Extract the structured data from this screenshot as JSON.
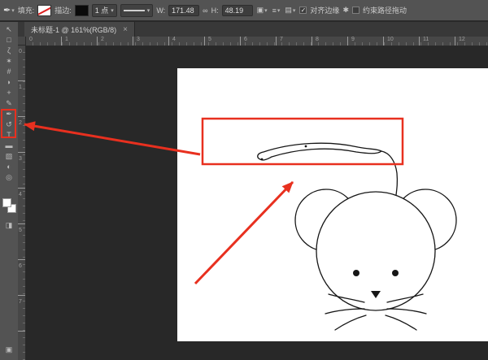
{
  "window": {
    "theme_colors": {
      "options_bar": "#535353",
      "pasteboard": "#282828",
      "canvas": "#ffffff",
      "ink": "#161616",
      "annotation_red": "#e8301f"
    }
  },
  "icons": {
    "pen": "✒",
    "dropdown": "▾",
    "link": "∞",
    "check": "✓",
    "path_ops": "▣",
    "path_align": "≡",
    "path_arrange": "▤",
    "gear": "✱",
    "quick_mask": "◨",
    "screen_mode": "▣"
  },
  "options_bar": {
    "fill_label": "填充:",
    "stroke_label": "描边:",
    "stroke_width": "1 点",
    "w_label": "W:",
    "w_value": "171.48",
    "h_label": "H:",
    "h_value": "48.19",
    "align_edges_label": "对齐边缘",
    "constrain_path_label": "约束路径拖动"
  },
  "tab_bar": {
    "document_title": "未标题-1 @ 161%(RGB/8)",
    "close_icon": "×"
  },
  "toolbar": {
    "tools": [
      {
        "name": "move-tool-icon",
        "glyph": "↖"
      },
      {
        "name": "marquee-tool-icon",
        "glyph": "□"
      },
      {
        "name": "lasso-tool-icon",
        "glyph": "ζ"
      },
      {
        "name": "quick-selection-tool-icon",
        "glyph": "✶"
      },
      {
        "name": "crop-tool-icon",
        "glyph": "#"
      },
      {
        "name": "eyedropper-tool-icon",
        "glyph": "◗"
      },
      {
        "name": "healing-brush-tool-icon",
        "glyph": "+"
      },
      {
        "name": "brush-tool-icon",
        "glyph": "✎"
      },
      {
        "name": "pen-tool-icon",
        "glyph": "✒"
      },
      {
        "name": "history-brush-tool-icon",
        "glyph": "↺"
      },
      {
        "name": "type-tool-icon",
        "glyph": "T"
      },
      {
        "name": "eraser-tool-icon",
        "glyph": "▬"
      },
      {
        "name": "gradient-tool-icon",
        "glyph": "▧"
      },
      {
        "name": "dodge-tool-icon",
        "glyph": "◐"
      },
      {
        "name": "zoom-tool-icon",
        "glyph": "◎"
      }
    ]
  },
  "rulers": {
    "horizontal": [
      "0",
      "1",
      "2",
      "3",
      "4",
      "5",
      "6",
      "7",
      "8",
      "9",
      "10",
      "11",
      "12"
    ],
    "vertical": [
      "0",
      "1",
      "2",
      "3",
      "4",
      "5",
      "6",
      "7"
    ]
  }
}
